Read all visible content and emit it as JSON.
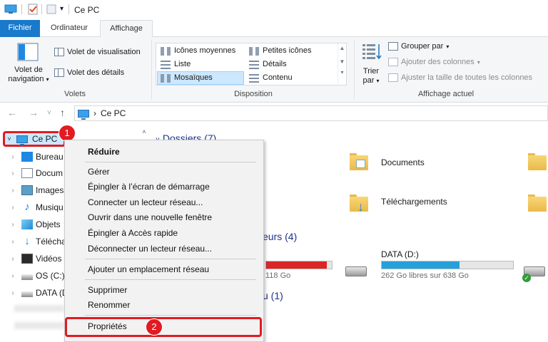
{
  "window": {
    "title": "Ce PC"
  },
  "ribbon": {
    "tabs": [
      "Fichier",
      "Ordinateur",
      "Affichage"
    ],
    "volets": {
      "nav_pane_label_1": "Volet de",
      "nav_pane_label_2": "navigation",
      "preview": "Volet de visualisation",
      "details": "Volet des détails",
      "group": "Volets"
    },
    "disposition": {
      "items": [
        "Icônes moyennes",
        "Petites icônes",
        "Liste",
        "Détails",
        "Mosaïques",
        "Contenu"
      ],
      "selected": "Mosaïques",
      "group": "Disposition"
    },
    "affichage_actuel": {
      "sort_1": "Trier",
      "sort_2": "par",
      "group_by": "Grouper par",
      "add_columns": "Ajouter des colonnes",
      "fit_columns": "Ajuster la taille de toutes les colonnes",
      "group": "Affichage actuel"
    }
  },
  "address": {
    "breadcrumb_sep": "›",
    "location": "Ce PC"
  },
  "nav_pane": {
    "items": [
      "Ce PC",
      "Bureau",
      "Docum",
      "Images",
      "Musiqu",
      "Objets",
      "Téléchar",
      "Vidéos",
      "OS (C:)",
      "DATA (D"
    ]
  },
  "content": {
    "folders_header": "Dossiers (7)",
    "folders": [
      "Documents",
      "Téléchargements"
    ],
    "devices_header_fragment": "eurs (4)",
    "network_header_fragment": "u (1)",
    "drive_c_free": "118 Go",
    "drive_d": {
      "name": "DATA (D:)",
      "free": "262 Go libres sur 638 Go",
      "used_fraction": 0.59
    },
    "drive_c_used_fraction": 0.92
  },
  "context_menu": {
    "items": [
      "Réduire",
      "Gérer",
      "Épingler à l’écran de démarrage",
      "Connecter un lecteur réseau...",
      "Ouvrir dans une nouvelle fenêtre",
      "Épingler à Accès rapide",
      "Déconnecter un lecteur réseau...",
      "Ajouter un emplacement réseau",
      "Supprimer",
      "Renommer",
      "Propriétés"
    ]
  },
  "annotations": {
    "badge_1": "1",
    "badge_2": "2"
  },
  "colors": {
    "accent": "#1979ca",
    "highlight": "#e11b22",
    "selection": "#cce8ff",
    "drive_c_bar": "#da2626",
    "drive_d_bar": "#26a0da"
  }
}
